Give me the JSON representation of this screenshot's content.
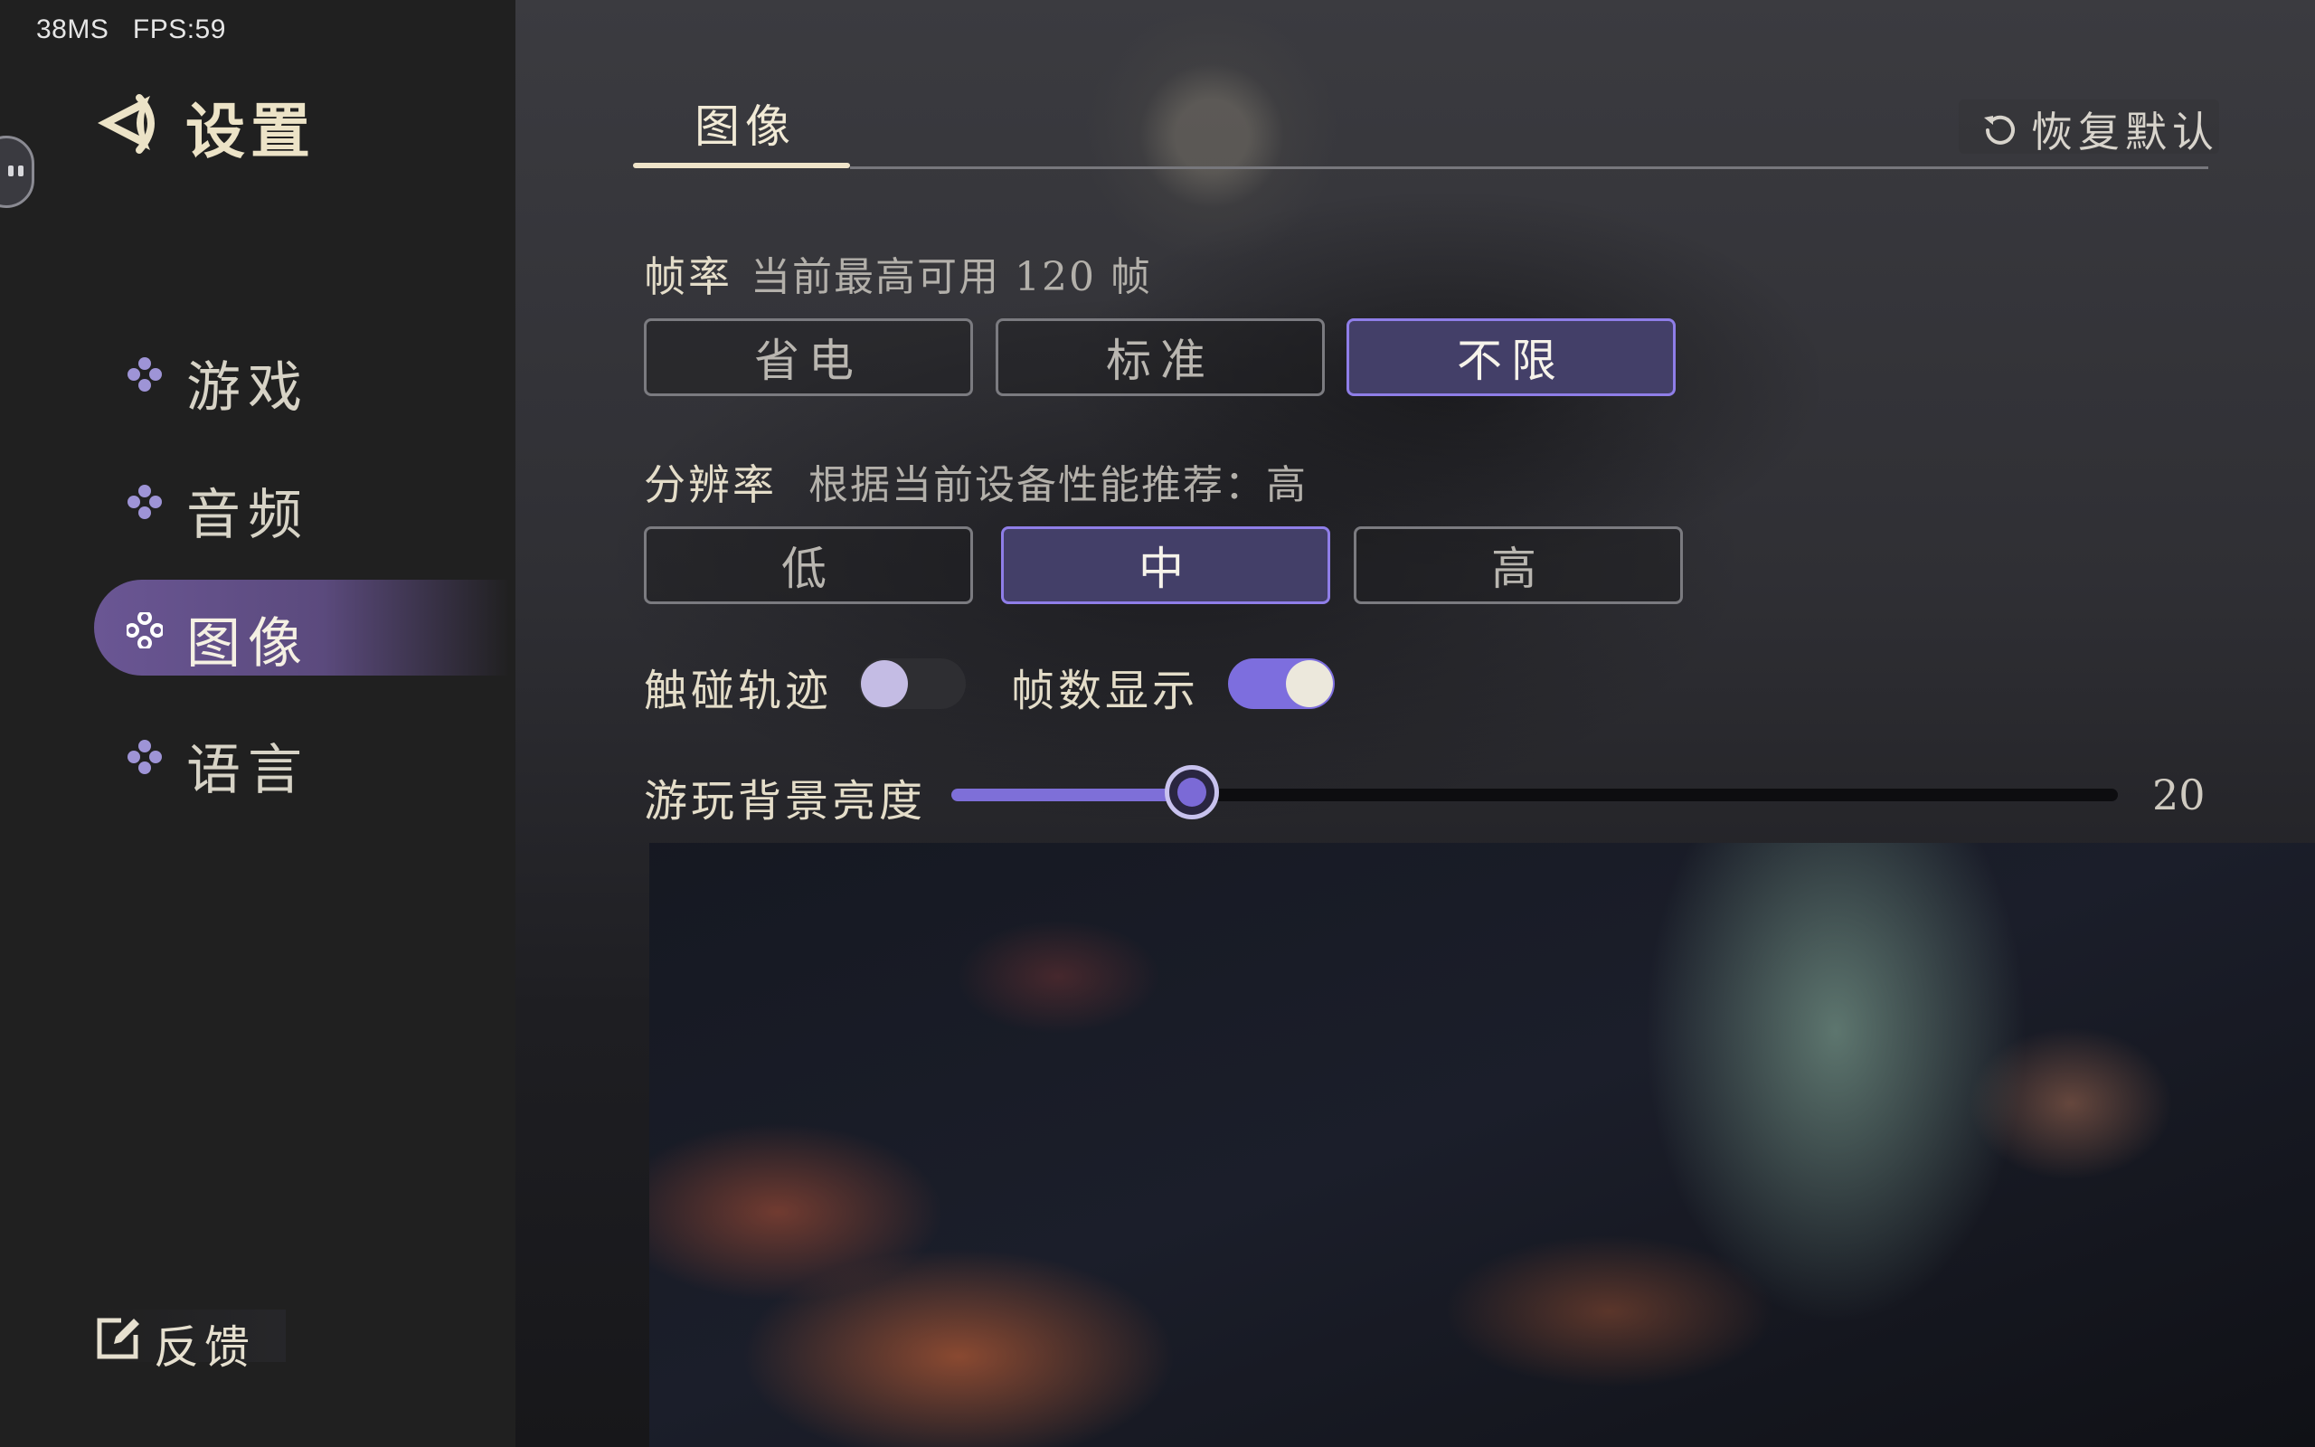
{
  "status": {
    "text": "38MS   FPS:59"
  },
  "sidebar": {
    "title": "设置",
    "items": [
      {
        "label": "游戏",
        "active": false
      },
      {
        "label": "音频",
        "active": false
      },
      {
        "label": "图像",
        "active": true
      },
      {
        "label": "语言",
        "active": false
      }
    ],
    "feedback_label": "反馈"
  },
  "header": {
    "active_tab": "图像",
    "restore_label": "恢复默认"
  },
  "framerate": {
    "title": "帧率",
    "subtitle": "当前最高可用 120 帧",
    "options": [
      "省电",
      "标准",
      "不限"
    ],
    "selected": "不限"
  },
  "resolution": {
    "title": "分辨率",
    "subtitle": "根据当前设备性能推荐：高",
    "options": [
      "低",
      "中",
      "高"
    ],
    "selected": "中"
  },
  "toggles": {
    "touch_trail": {
      "label": "触碰轨迹",
      "on": false
    },
    "fps_display": {
      "label": "帧数显示",
      "on": true
    }
  },
  "brightness": {
    "label": "游玩背景亮度",
    "value": "20",
    "fraction": 0.206
  },
  "colors": {
    "accent": "#7e6fd8",
    "selected_bg": "#433f68",
    "selected_border": "#8f7ee8",
    "nav_active": "#6a5694",
    "text_cream": "#ece3c7"
  },
  "icons": {
    "back": "back-arrow-icon",
    "nav": "four-dot-diamond-icon",
    "restore": "refresh-icon",
    "feedback": "edit-icon"
  }
}
